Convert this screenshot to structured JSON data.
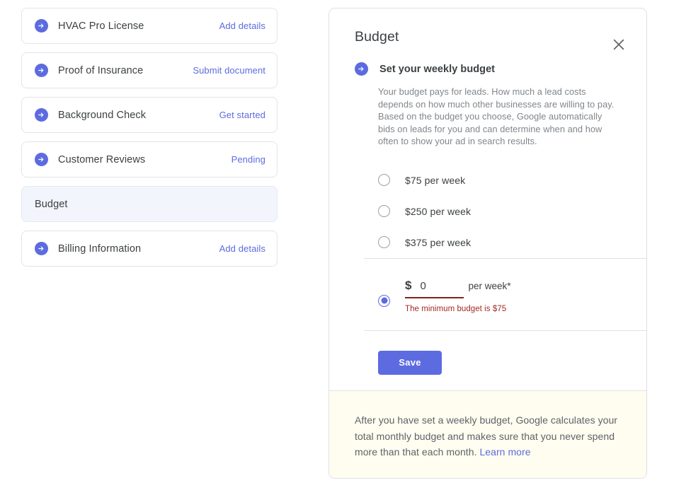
{
  "checklist": {
    "items": [
      {
        "label": "HVAC Pro License",
        "action": "Add details",
        "icon": "arrow-right-circle-icon",
        "selected": false
      },
      {
        "label": "Proof of Insurance",
        "action": "Submit document",
        "icon": "arrow-right-circle-icon",
        "selected": false
      },
      {
        "label": "Background Check",
        "action": "Get started",
        "icon": "arrow-right-circle-icon",
        "selected": false
      },
      {
        "label": "Customer Reviews",
        "action": "Pending",
        "icon": "arrow-right-circle-icon",
        "selected": false
      },
      {
        "label": "Budget",
        "action": "",
        "icon": "",
        "selected": true
      },
      {
        "label": "Billing Information",
        "action": "Add details",
        "icon": "arrow-right-circle-icon",
        "selected": false
      }
    ]
  },
  "dialog": {
    "title": "Budget",
    "close_icon": "close-icon",
    "section": {
      "icon": "arrow-right-circle-icon",
      "heading": "Set your weekly budget",
      "description": "Your budget pays for leads. How much a lead costs depends on how much other businesses are willing to pay. Based on the budget you choose, Google automatically bids on leads for you and can determine when and how often to show your ad in search results."
    },
    "options": [
      {
        "label": "$75 per week",
        "selected": false
      },
      {
        "label": "$250 per week",
        "selected": false
      },
      {
        "label": "$375 per week",
        "selected": false
      }
    ],
    "custom": {
      "selected": true,
      "currency_symbol": "$",
      "amount_value": "0",
      "amount_placeholder": "0",
      "suffix": "per week*",
      "error": "The minimum budget is $75"
    },
    "save_label": "Save",
    "footer": {
      "text": "After you have set a weekly budget, Google calculates your total monthly budget and makes sure that you never spend more than that each month. ",
      "link_label": "Learn more"
    }
  },
  "colors": {
    "accent": "#5c6bdf",
    "error": "#a02b25",
    "error_underline": "#80231f",
    "text_primary": "#3c4043",
    "text_muted": "#80868b",
    "footer_bg": "#fefdf0",
    "selected_card_bg": "#f2f6fc"
  }
}
